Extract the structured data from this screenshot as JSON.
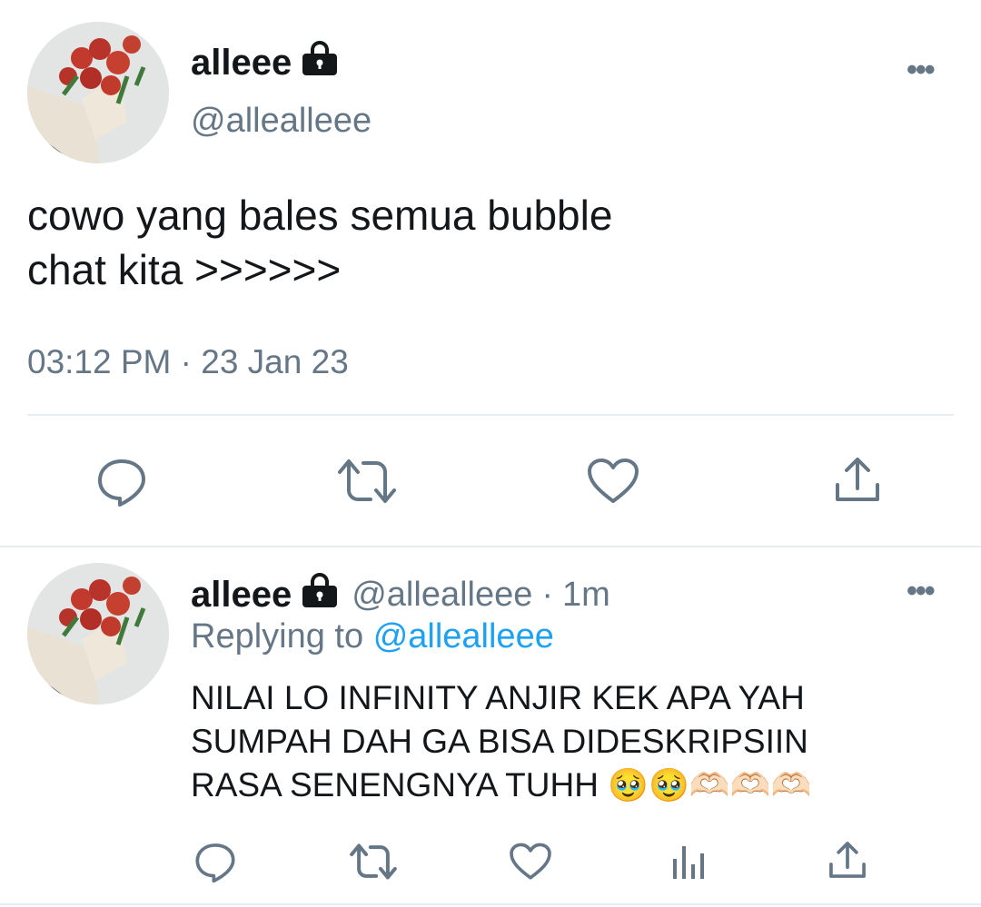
{
  "tweet": {
    "author_name": "alleee",
    "author_handle": "@allealleee",
    "text_line1": "cowo yang bales semua bubble",
    "text_line2": "chat kita >>>>>>",
    "timestamp": "03:12 PM · 23 Jan 23",
    "more": "•••",
    "actions": [
      "reply-icon",
      "retweet-icon",
      "like-icon",
      "share-icon"
    ]
  },
  "reply": {
    "author_name": "alleee",
    "author_handle": "@allealleee",
    "separator": "·",
    "time": "1m",
    "replying_label": "Replying to",
    "replying_handle": "@allealleee",
    "text_line1": "NILAI LO INFINITY ANJIR KEK APA YAH",
    "text_line2": "SUMPAH DAH GA BISA DIDESKRIPSIIN",
    "text_line3": "RASA SENENGNYA TUHH",
    "emojis": "🥹🥹🫶🏻🫶🏻🫶🏻",
    "more": "•••",
    "actions": [
      "reply-icon",
      "retweet-icon",
      "like-icon",
      "analytics-icon",
      "share-icon"
    ]
  },
  "colors": {
    "text": "#14171a",
    "secondary": "#657786",
    "link": "#1da1f2",
    "divider": "#e6ecf0"
  }
}
